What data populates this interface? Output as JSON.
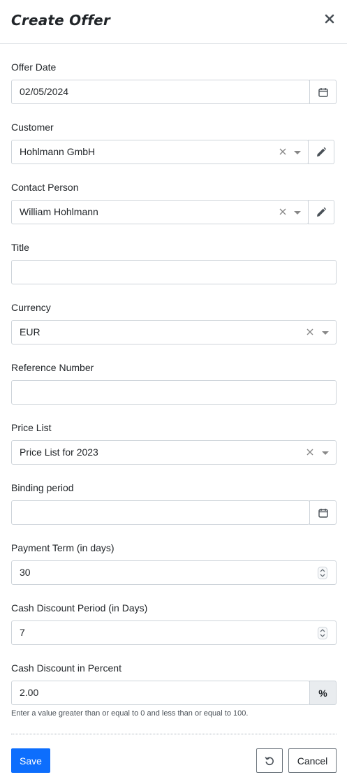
{
  "dialog": {
    "title": "Create Offer"
  },
  "fields": {
    "offer_date": {
      "label": "Offer Date",
      "value": "02/05/2024"
    },
    "customer": {
      "label": "Customer",
      "value": "Hohlmann GmbH"
    },
    "contact_person": {
      "label": "Contact Person",
      "value": "William Hohlmann"
    },
    "title": {
      "label": "Title",
      "value": ""
    },
    "currency": {
      "label": "Currency",
      "value": "EUR"
    },
    "reference_number": {
      "label": "Reference Number",
      "value": ""
    },
    "price_list": {
      "label": "Price List",
      "value": "Price List for 2023"
    },
    "binding_period": {
      "label": "Binding period",
      "value": ""
    },
    "payment_term": {
      "label": "Payment Term (in days)",
      "value": "30"
    },
    "cash_discount_period": {
      "label": "Cash Discount Period (in Days)",
      "value": "7"
    },
    "cash_discount_percent": {
      "label": "Cash Discount in Percent",
      "value": "2.00",
      "addon": "%",
      "help": "Enter a value greater than or equal to 0 and less than or equal to 100."
    }
  },
  "buttons": {
    "save": "Save",
    "cancel": "Cancel"
  },
  "icons": {
    "close": "close-icon",
    "calendar": "calendar-icon",
    "clear": "clear-icon",
    "dropdown": "chevron-down-icon",
    "edit": "pencil-icon",
    "spinner": "spinner-arrows-icon",
    "reset": "reset-icon"
  },
  "colors": {
    "primary": "#0d6efd",
    "border": "#ced4da",
    "addon_bg": "#e9ecef"
  }
}
